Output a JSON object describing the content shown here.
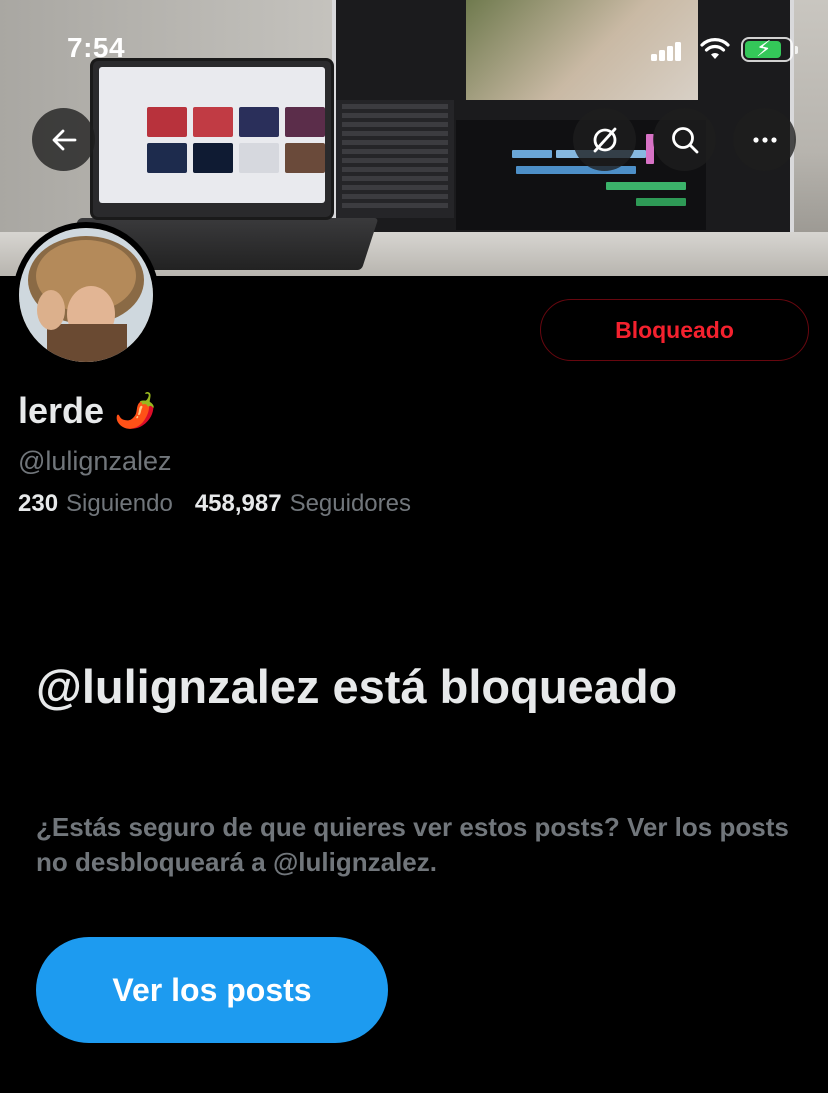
{
  "status_bar": {
    "time": "7:54"
  },
  "banner_actions": {
    "back": "arrow-left-icon",
    "grok": "grok-slash-icon",
    "search": "search-icon",
    "more": "more-horizontal-icon"
  },
  "profile": {
    "display_name": "lerde",
    "name_emoji": "🌶️",
    "handle": "@lulignzalez",
    "following_count": "230",
    "following_label": "Siguiendo",
    "followers_count": "458,987",
    "followers_label": "Seguidores",
    "blocked_button": "Bloqueado"
  },
  "blocked_notice": {
    "title": "@lulignzalez está bloqueado",
    "description": "¿Estás seguro de que quieres ver estos posts? Ver los posts no desbloqueará a @lulignzalez.",
    "view_button": "Ver los posts"
  },
  "colors": {
    "background": "#000000",
    "primary_text": "#e7e9ea",
    "secondary_text": "#71767b",
    "danger": "#f4212e",
    "accent": "#1d9bf0"
  }
}
